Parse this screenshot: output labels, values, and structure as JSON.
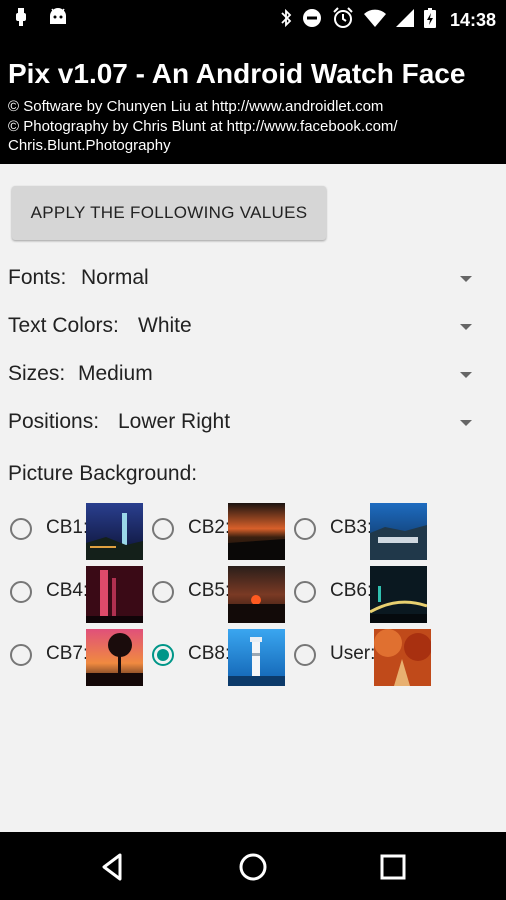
{
  "status_bar": {
    "time": "14:38",
    "left_icons": [
      "usb-icon",
      "android-icon"
    ],
    "right_icons": [
      "bluetooth-icon",
      "do-not-disturb-icon",
      "alarm-icon",
      "wifi-icon",
      "cell-signal-icon",
      "battery-icon"
    ]
  },
  "header": {
    "title": "Pix v1.07 - An Android Watch Face",
    "credit_software": "© Software by Chunyen Liu at http://www.androidlet.com",
    "credit_photo_line1": "© Photography by Chris Blunt at http://www.facebook.com/",
    "credit_photo_line2": "Chris.Blunt.Photography"
  },
  "apply_button": {
    "label": "APPLY THE FOLLOWING VALUES"
  },
  "settings": [
    {
      "label": "Fonts:",
      "value": "Normal"
    },
    {
      "label": "Text Colors:",
      "value": "White"
    },
    {
      "label": "Sizes:",
      "value": "Medium"
    },
    {
      "label": "Positions:",
      "value": "Lower Right"
    }
  ],
  "background": {
    "heading": "Picture Background:",
    "selected": "CB8",
    "options": [
      {
        "label": "CB1:",
        "checked": false
      },
      {
        "label": "CB2:",
        "checked": false
      },
      {
        "label": "CB3:",
        "checked": false
      },
      {
        "label": "CB4:",
        "checked": false
      },
      {
        "label": "CB5:",
        "checked": false
      },
      {
        "label": "CB6:",
        "checked": false
      },
      {
        "label": "CB7:",
        "checked": false
      },
      {
        "label": "CB8:",
        "checked": true
      },
      {
        "label": "User:",
        "checked": false
      }
    ]
  },
  "nav_bar": {
    "icons": [
      "back-icon",
      "home-icon",
      "recents-icon"
    ]
  },
  "colors": {
    "accent": "#009688",
    "header_bg": "#000000",
    "content_bg": "#f2f2f2",
    "button_bg": "#d6d6d6"
  }
}
